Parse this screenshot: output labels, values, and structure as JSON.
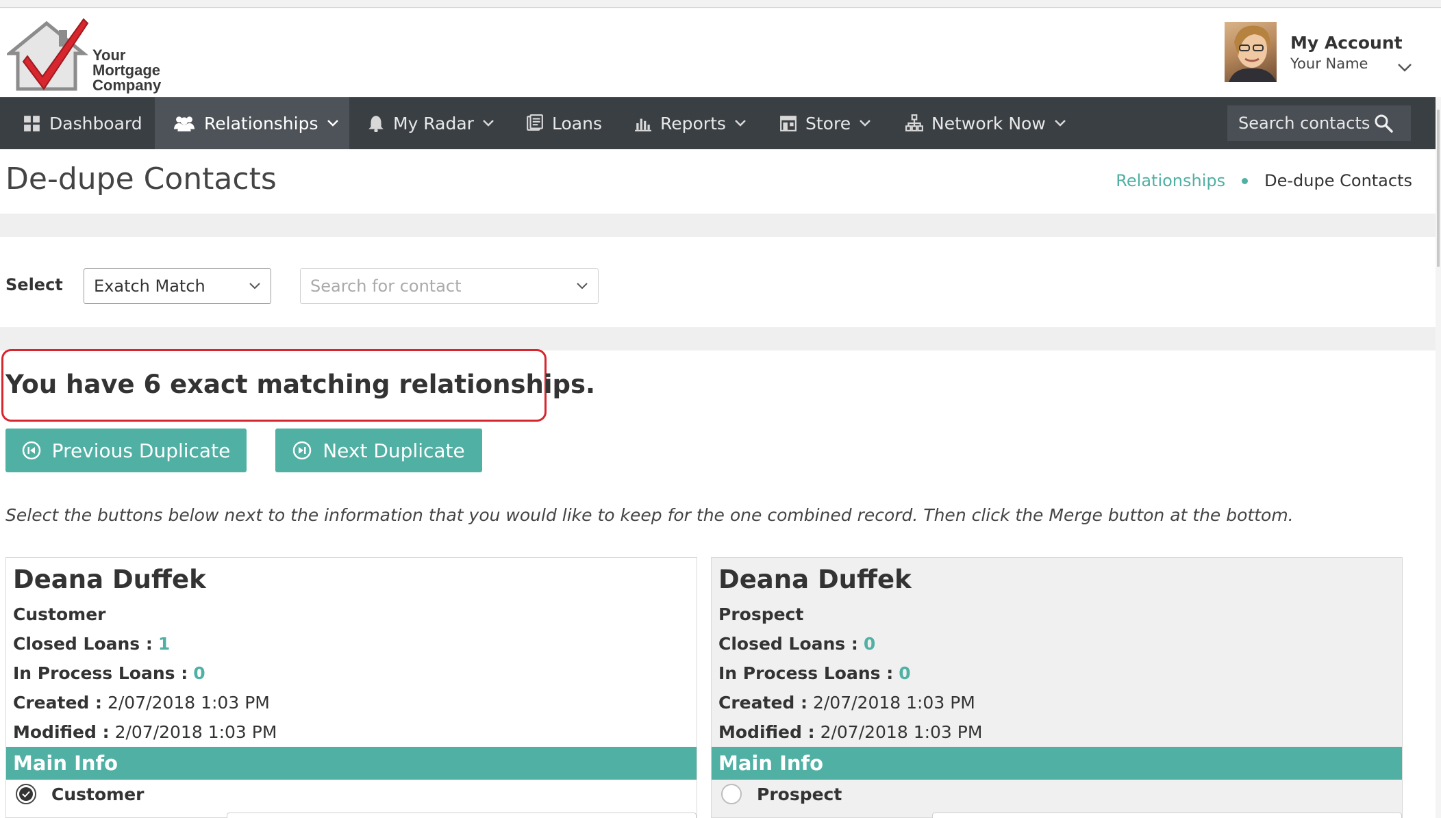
{
  "brand": {
    "line1": "Your",
    "line2": "Mortgage",
    "line3": "Company",
    "accent": "#d7262e"
  },
  "account": {
    "title": "My Account",
    "name": "Your Name"
  },
  "nav": {
    "items": [
      {
        "label": "Dashboard",
        "icon": "dashboard-icon"
      },
      {
        "label": "Relationships",
        "icon": "users-icon"
      },
      {
        "label": "My Radar",
        "icon": "bell-icon"
      },
      {
        "label": "Loans",
        "icon": "loans-icon"
      },
      {
        "label": "Reports",
        "icon": "bar-chart-icon"
      },
      {
        "label": "Store",
        "icon": "store-icon"
      },
      {
        "label": "Network Now",
        "icon": "network-icon"
      }
    ],
    "active": "Relationships",
    "search_placeholder": "Search contacts"
  },
  "page": {
    "title": "De-dupe Contacts",
    "breadcrumb": {
      "parent": "Relationships",
      "current": "De-dupe Contacts"
    }
  },
  "filters": {
    "select_label": "Select",
    "match_type": "Exatch Match",
    "contact_placeholder": "Search for contact"
  },
  "summary": {
    "text": "You have 6 exact matching relationships."
  },
  "buttons": {
    "previous": "Previous Duplicate",
    "next": "Next Duplicate"
  },
  "instructions": "Select the buttons below next to the information that you would like to keep for the one combined record. Then click the Merge button at the bottom.",
  "labels": {
    "closed_loans": "Closed Loans :",
    "in_process_loans": "In Process Loans :",
    "created": "Created :",
    "modified": "Modified :",
    "section": "Main Info"
  },
  "contacts": [
    {
      "name": "Deana Duffek",
      "type": "Customer",
      "closed_loans": "1",
      "in_process_loans": "0",
      "created": "2/07/2018 1:03 PM",
      "modified": "2/07/2018 1:03 PM",
      "option": "Customer",
      "selected": true
    },
    {
      "name": "Deana Duffek",
      "type": "Prospect",
      "closed_loans": "0",
      "in_process_loans": "0",
      "created": "2/07/2018 1:03 PM",
      "modified": "2/07/2018 1:03 PM",
      "option": "Prospect",
      "selected": false
    }
  ],
  "colors": {
    "teal": "#4fb0a3",
    "nav_bg": "#3a3f44",
    "highlight": "#d7262e"
  }
}
